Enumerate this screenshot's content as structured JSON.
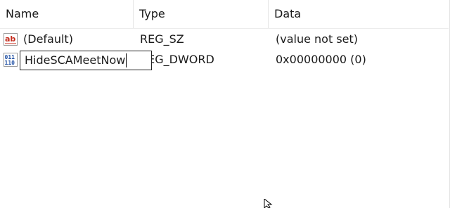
{
  "columns": {
    "name": "Name",
    "type": "Type",
    "data": "Data"
  },
  "rows": [
    {
      "icon": "string-value-icon",
      "name": "(Default)",
      "type": "REG_SZ",
      "data": "(value not set)"
    },
    {
      "icon": "dword-value-icon",
      "name": "HideSCAMeetNow",
      "type": "REG_DWORD",
      "data": "0x00000000 (0)"
    }
  ],
  "rename": {
    "value": "HideSCAMeetNow"
  },
  "colors": {
    "text": "#1a1a1a",
    "header_separator": "#e5e5e5",
    "edit_border": "#222222",
    "icon_red": "#c42b1c",
    "icon_blue": "#1f4fa3"
  }
}
